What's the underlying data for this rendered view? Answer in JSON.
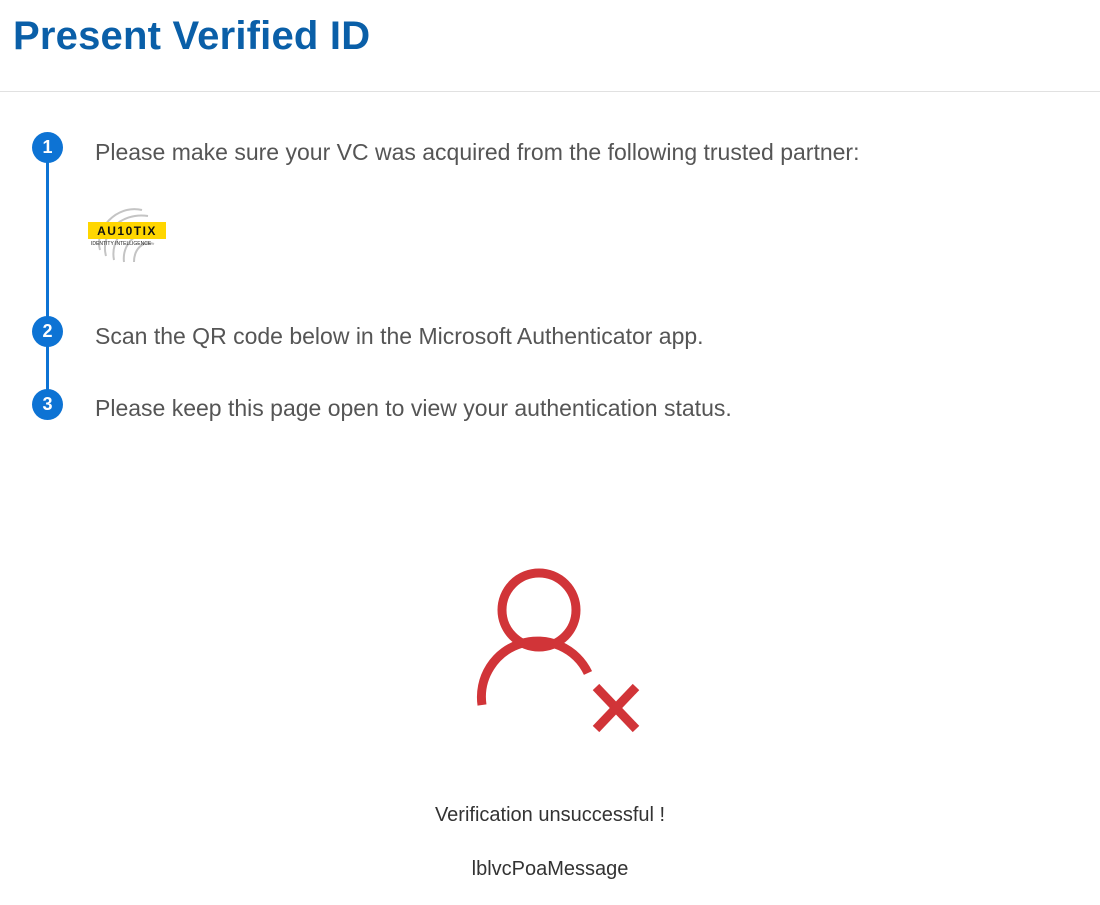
{
  "header": {
    "title": "Present Verified ID"
  },
  "steps": [
    {
      "number": "1",
      "text": "Please make sure your VC was acquired from the following trusted partner:"
    },
    {
      "number": "2",
      "text": "Scan the QR code below in the Microsoft Authenticator app."
    },
    {
      "number": "3",
      "text": "Please keep this page open to view your authentication status."
    }
  ],
  "partner": {
    "name": "AU10TIX",
    "tagline": "IDENTITY INTELLIGENCE",
    "icon": "au10tix-logo"
  },
  "status": {
    "icon": "user-x-icon",
    "message": "Verification unsuccessful !",
    "detail": "lblvcPoaMessage"
  },
  "colors": {
    "title": "#0a5fa8",
    "step_accent": "#0d73d4",
    "error": "#d13438",
    "logo_yellow": "#ffd600"
  }
}
